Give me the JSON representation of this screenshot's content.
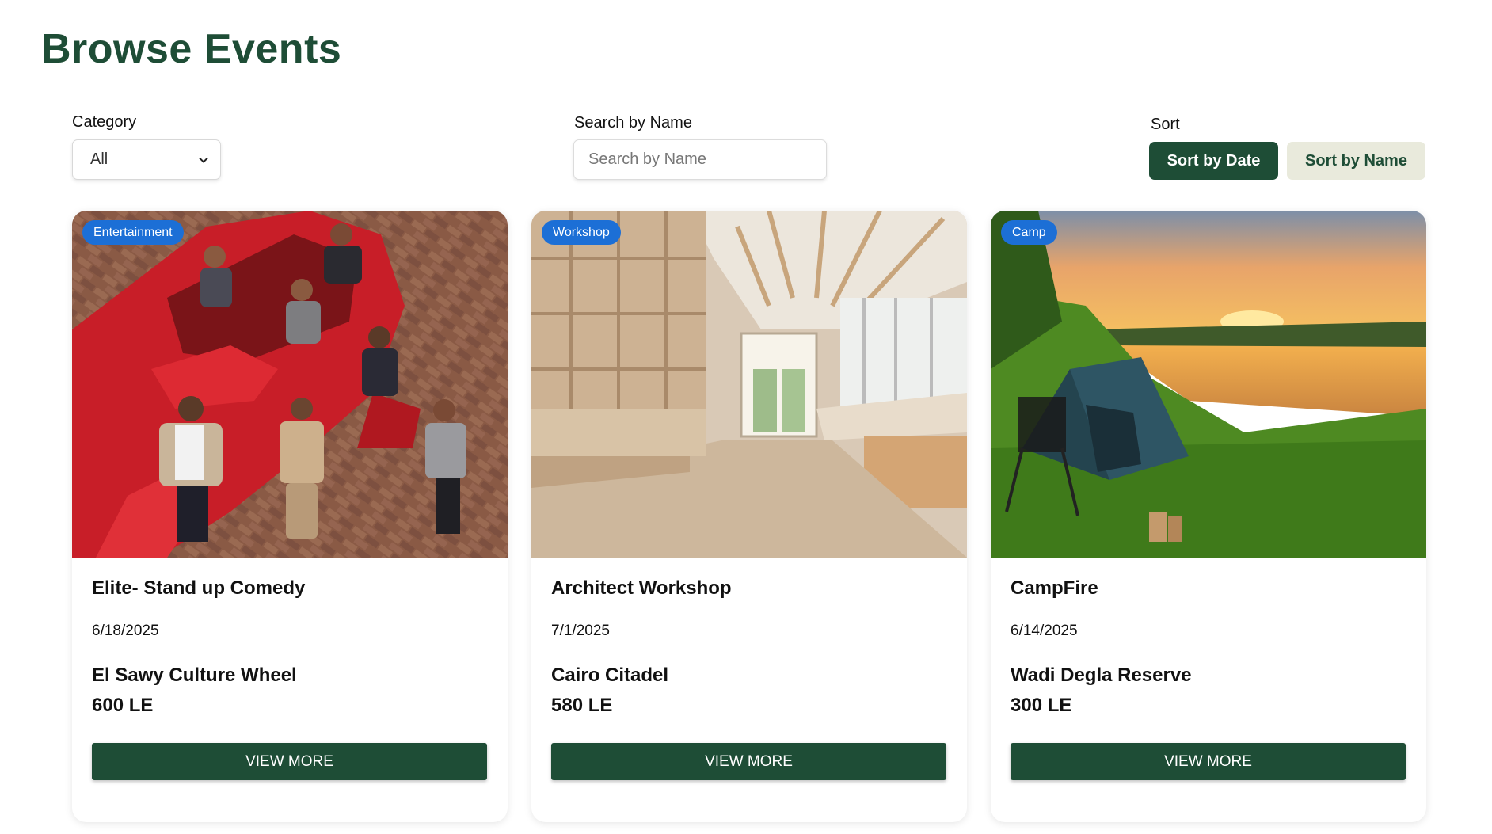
{
  "page": {
    "title": "Browse Events"
  },
  "filters": {
    "category_label": "Category",
    "category_value": "All",
    "search_label": "Search by Name",
    "search_placeholder": "Search by Name",
    "sort_label": "Sort",
    "sort_by_date": "Sort by Date",
    "sort_by_name": "Sort by Name",
    "active_sort": "date"
  },
  "colors": {
    "brand_green": "#1e4d36",
    "badge_blue": "#1c6fd6",
    "secondary_button": "#e9eadc"
  },
  "events": [
    {
      "badge": "Entertainment",
      "title": "Elite- Stand up Comedy",
      "date": "6/18/2025",
      "venue": "El Sawy Culture Wheel",
      "price": "600 LE",
      "button": "VIEW MORE",
      "image": "comedy-group-red-car-photo"
    },
    {
      "badge": "Workshop",
      "title": "Architect Workshop",
      "date": "7/1/2025",
      "venue": "Cairo Citadel",
      "price": "580 LE",
      "button": "VIEW MORE",
      "image": "wooden-interior-photo"
    },
    {
      "badge": "Camp",
      "title": "CampFire",
      "date": "6/14/2025",
      "venue": "Wadi Degla Reserve",
      "price": "300 LE",
      "button": "VIEW MORE",
      "image": "tent-riverside-sunset-photo"
    }
  ]
}
